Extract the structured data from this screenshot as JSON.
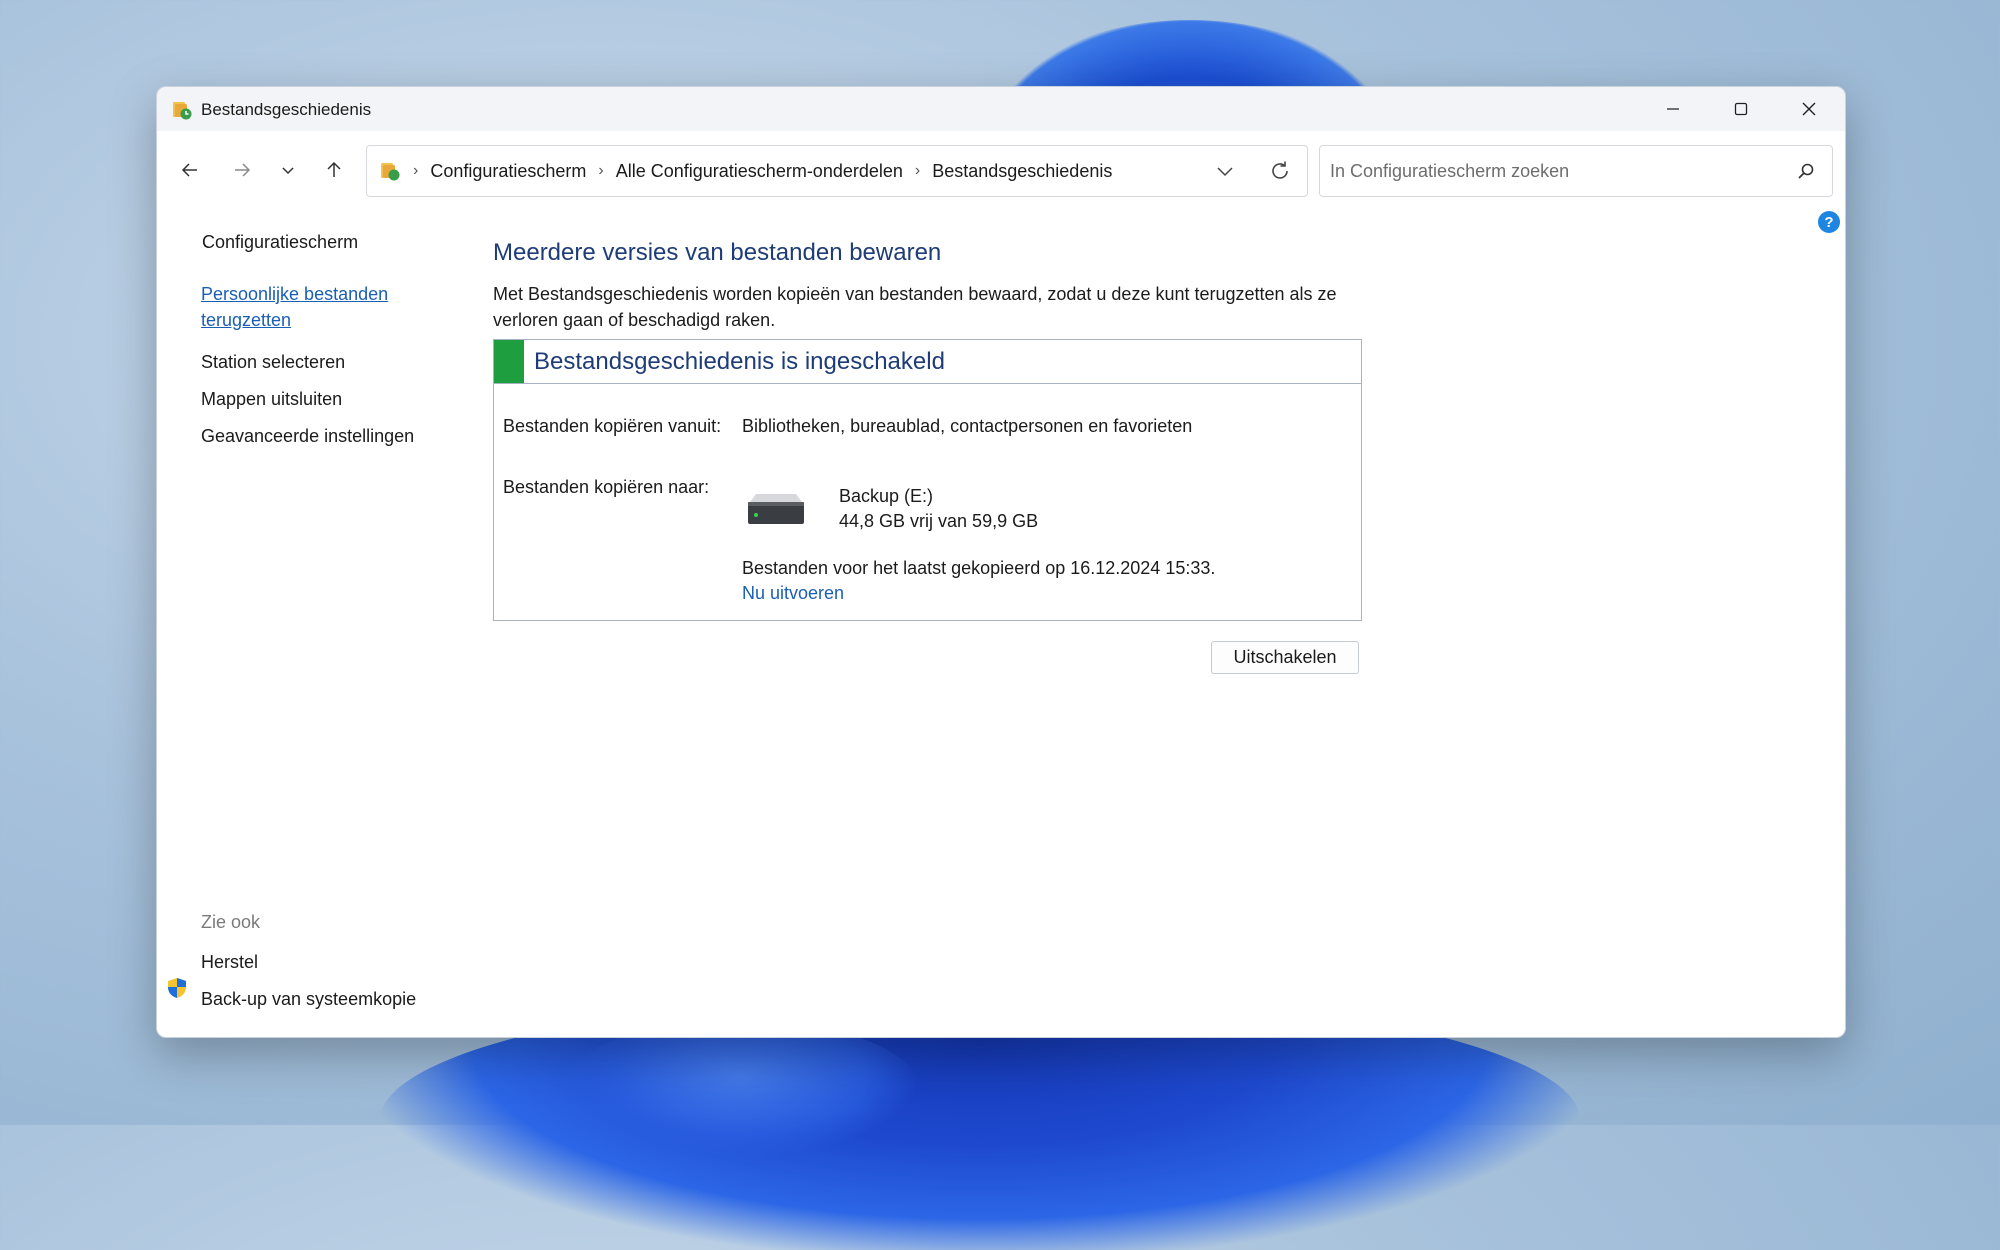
{
  "window": {
    "title": "Bestandsgeschiedenis"
  },
  "address": {
    "crumbs": [
      "Configuratiescherm",
      "Alle Configuratiescherm-onderdelen",
      "Bestandsgeschiedenis"
    ],
    "separator": "›"
  },
  "search": {
    "placeholder": "In Configuratiescherm zoeken"
  },
  "sidebar": {
    "home": "Configuratiescherm",
    "links": [
      "Persoonlijke bestanden terugzetten",
      "Station selecteren",
      "Mappen uitsluiten",
      "Geavanceerde instellingen"
    ],
    "see_also_label": "Zie ook",
    "see_also": [
      "Herstel",
      "Back-up van systeemkopie"
    ]
  },
  "main": {
    "title": "Meerdere versies van bestanden bewaren",
    "description": "Met Bestandsgeschiedenis worden kopieën van bestanden bewaard, zodat u deze kunt terugzetten als ze verloren gaan of beschadigd raken.",
    "status_title": "Bestandsgeschiedenis is ingeschakeld",
    "status_color": "#1e9e3e",
    "copy_from_label": "Bestanden kopiëren vanuit:",
    "copy_from_value": "Bibliotheken, bureaublad, contactpersonen en favorieten",
    "copy_to_label": "Bestanden kopiëren naar:",
    "drive_name": "Backup (E:)",
    "drive_space": "44,8 GB vrij van 59,9 GB",
    "last_copied": "Bestanden voor het laatst gekopieerd op 16.12.2024 15:33.",
    "run_now": "Nu uitvoeren",
    "disable_button": "Uitschakelen"
  },
  "help": {
    "glyph": "?"
  },
  "colors": {
    "link": "#1a5fb4",
    "heading": "#1e3c78",
    "accent": "#1e86e0"
  }
}
